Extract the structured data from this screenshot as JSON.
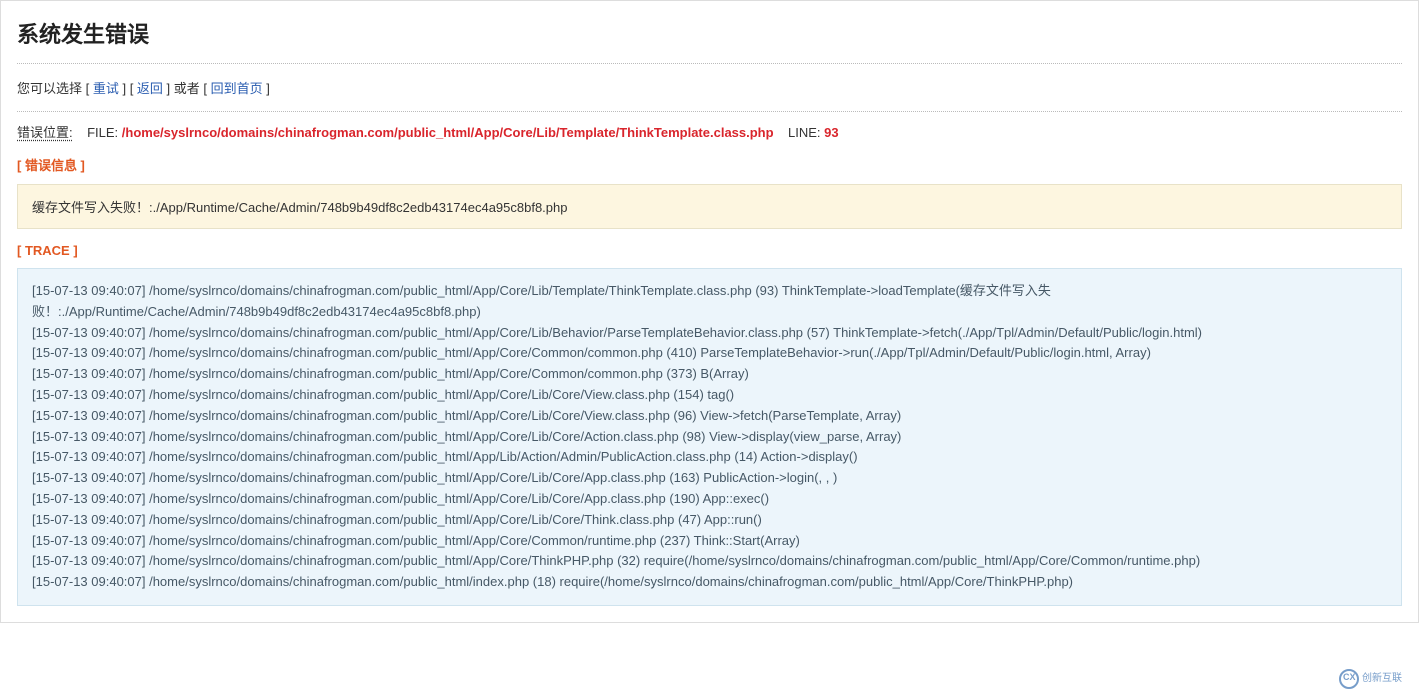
{
  "header": {
    "title": "系统发生错误"
  },
  "nav": {
    "prefix": "您可以选择 [ ",
    "retry": "重试",
    "sep1": " ] [ ",
    "back": "返回",
    "sep2": " ] 或者 [ ",
    "home": "回到首页",
    "suffix": " ]"
  },
  "location": {
    "label": "错误位置:",
    "file_label": "FILE: ",
    "file_path": "/home/syslrnco/domains/chinafrogman.com/public_html/App/Core/Lib/Template/ThinkTemplate.class.php",
    "line_label": "LINE: ",
    "line_number": "93"
  },
  "error_info": {
    "section_label": "[ 错误信息 ]",
    "message": "缓存文件写入失败！:./App/Runtime/Cache/Admin/748b9b49df8c2edb43174ec4a95c8bf8.php"
  },
  "trace": {
    "section_label": "[ TRACE ]",
    "lines": [
      "[15-07-13 09:40:07] /home/syslrnco/domains/chinafrogman.com/public_html/App/Core/Lib/Template/ThinkTemplate.class.php (93) ThinkTemplate->loadTemplate(缓存文件写入失败！:./App/Runtime/Cache/Admin/748b9b49df8c2edb43174ec4a95c8bf8.php)",
      "[15-07-13 09:40:07] /home/syslrnco/domains/chinafrogman.com/public_html/App/Core/Lib/Behavior/ParseTemplateBehavior.class.php (57) ThinkTemplate->fetch(./App/Tpl/Admin/Default/Public/login.html)",
      "[15-07-13 09:40:07] /home/syslrnco/domains/chinafrogman.com/public_html/App/Core/Common/common.php (410) ParseTemplateBehavior->run(./App/Tpl/Admin/Default/Public/login.html, Array)",
      "[15-07-13 09:40:07] /home/syslrnco/domains/chinafrogman.com/public_html/App/Core/Common/common.php (373) B(Array)",
      "[15-07-13 09:40:07] /home/syslrnco/domains/chinafrogman.com/public_html/App/Core/Lib/Core/View.class.php (154) tag()",
      "[15-07-13 09:40:07] /home/syslrnco/domains/chinafrogman.com/public_html/App/Core/Lib/Core/View.class.php (96) View->fetch(ParseTemplate, Array)",
      "[15-07-13 09:40:07] /home/syslrnco/domains/chinafrogman.com/public_html/App/Core/Lib/Core/Action.class.php (98) View->display(view_parse, Array)",
      "[15-07-13 09:40:07] /home/syslrnco/domains/chinafrogman.com/public_html/App/Lib/Action/Admin/PublicAction.class.php (14) Action->display()",
      "[15-07-13 09:40:07] /home/syslrnco/domains/chinafrogman.com/public_html/App/Core/Lib/Core/App.class.php (163) PublicAction->login(, , )",
      "[15-07-13 09:40:07] /home/syslrnco/domains/chinafrogman.com/public_html/App/Core/Lib/Core/App.class.php (190) App::exec()",
      "[15-07-13 09:40:07] /home/syslrnco/domains/chinafrogman.com/public_html/App/Core/Lib/Core/Think.class.php (47) App::run()",
      "[15-07-13 09:40:07] /home/syslrnco/domains/chinafrogman.com/public_html/App/Core/Common/runtime.php (237) Think::Start(Array)",
      "[15-07-13 09:40:07] /home/syslrnco/domains/chinafrogman.com/public_html/App/Core/ThinkPHP.php (32) require(/home/syslrnco/domains/chinafrogman.com/public_html/App/Core/Common/runtime.php)",
      "[15-07-13 09:40:07] /home/syslrnco/domains/chinafrogman.com/public_html/index.php (18) require(/home/syslrnco/domains/chinafrogman.com/public_html/App/Core/ThinkPHP.php)"
    ]
  },
  "watermark": {
    "brand": "创新互联"
  }
}
